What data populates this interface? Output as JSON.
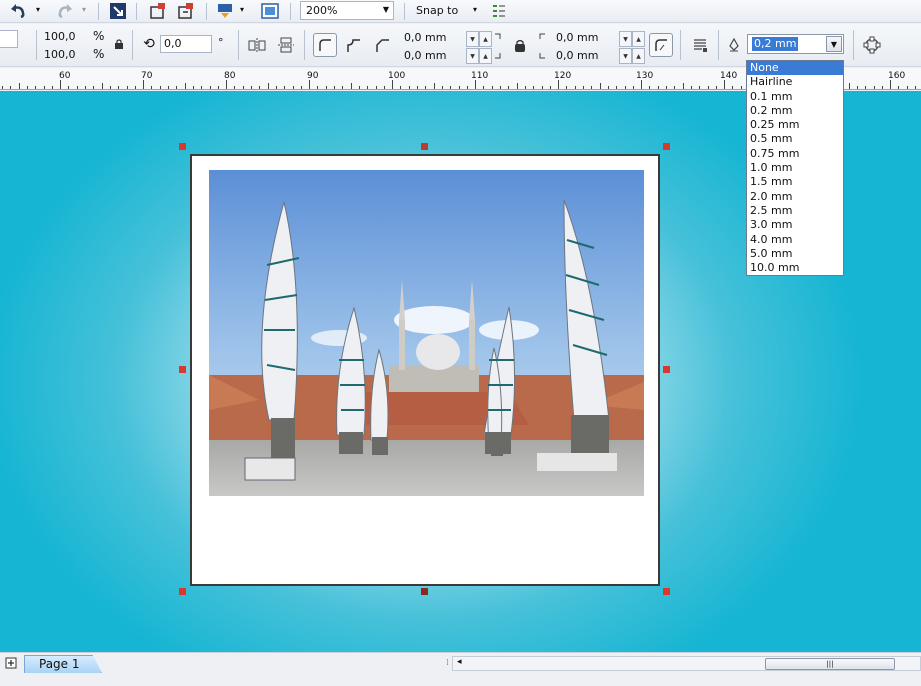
{
  "toolbar": {
    "zoom_value": "200%",
    "snap_label": "Snap to"
  },
  "property_bar": {
    "scale_x": "100,0",
    "scale_y": "100,0",
    "pct_x": "%",
    "pct_y": "%",
    "rotation": "0,0",
    "degree": "°",
    "corner_x1": "0,0 mm",
    "corner_y1": "0,0 mm",
    "corner_x2": "0,0 mm",
    "corner_y2": "0,0 mm",
    "outline_width": "0,2 mm"
  },
  "ruler": {
    "labels": [
      "60",
      "70",
      "80",
      "90",
      "100",
      "110",
      "120",
      "130",
      "140",
      "160"
    ]
  },
  "outline_options": [
    "None",
    "Hairline",
    "0.1 mm",
    "0.2 mm",
    "0.25 mm",
    "0.5 mm",
    "0.75 mm",
    "1.0 mm",
    "1.5 mm",
    "2.0 mm",
    "2.5 mm",
    "3.0 mm",
    "4.0 mm",
    "5.0 mm",
    "10.0 mm"
  ],
  "selected_option": "None",
  "bottom": {
    "page_tab": "Page 1"
  },
  "colors": {
    "canvas": "#15b5d3",
    "selection_handle": "#d9382b",
    "highlight": "#3a7bd5"
  }
}
